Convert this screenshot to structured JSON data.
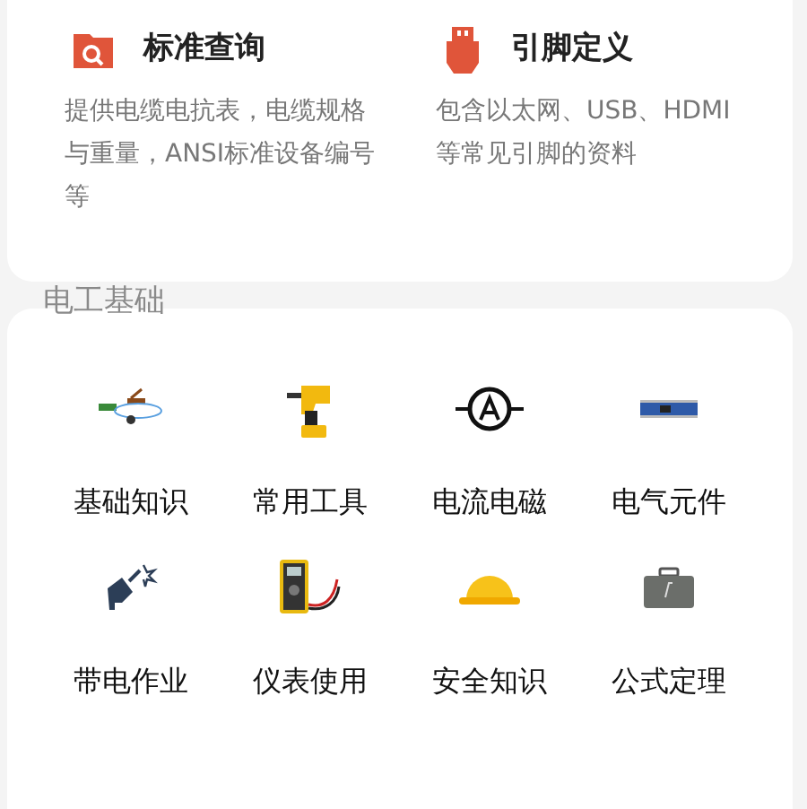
{
  "features": [
    {
      "title": "标准查询",
      "description": "提供电缆电抗表，电缆规格与重量，ANSI标准设备编号等"
    },
    {
      "title": "引脚定义",
      "description": "包含以太网、USB、HDMI等常见引脚的资料"
    }
  ],
  "section": {
    "title": "电工基础",
    "items": [
      {
        "label": "基础知识"
      },
      {
        "label": "常用工具"
      },
      {
        "label": "电流电磁"
      },
      {
        "label": "电气元件"
      },
      {
        "label": "带电作业"
      },
      {
        "label": "仪表使用"
      },
      {
        "label": "安全知识"
      },
      {
        "label": "公式定理"
      }
    ]
  }
}
